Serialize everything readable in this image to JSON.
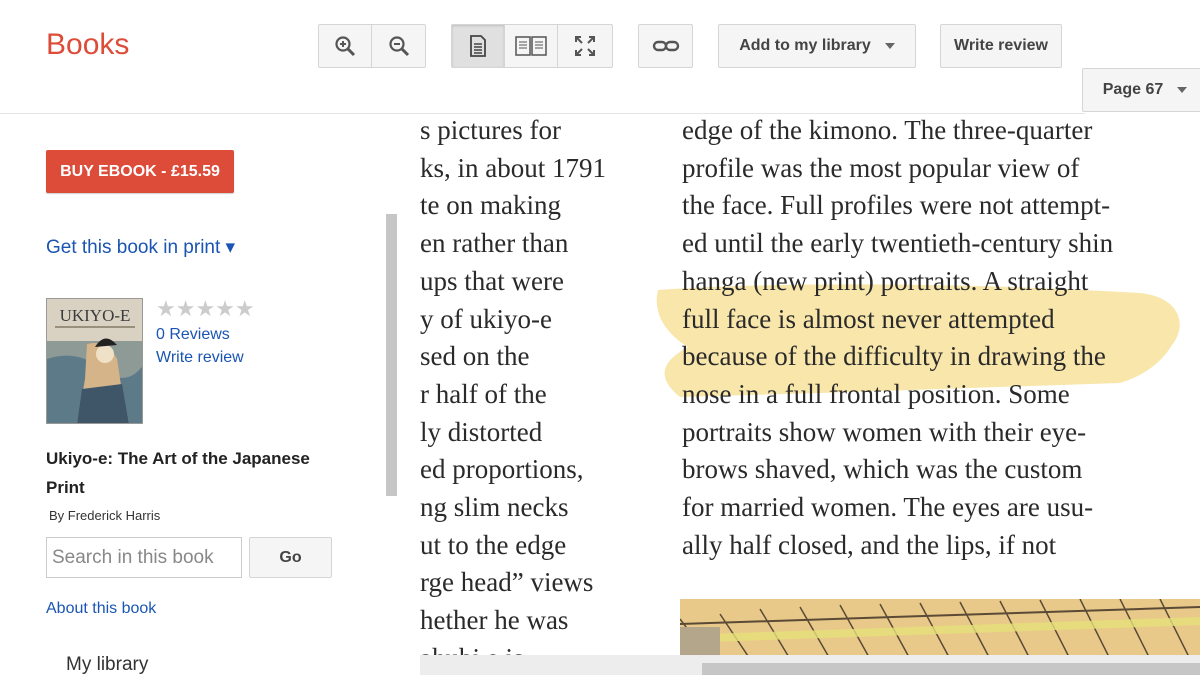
{
  "header": {
    "logo": "Books",
    "add_library": "Add to my library",
    "write_review": "Write review",
    "page_label": "Page 67"
  },
  "icons": [
    "zoom-in-icon",
    "zoom-out-icon",
    "single-page-icon",
    "two-page-icon",
    "fullscreen-icon",
    "link-icon"
  ],
  "sidebar": {
    "buy": "BUY EBOOK - £15.59",
    "print": "Get this book in print ▾",
    "stars": "★★★★★",
    "reviews": "0 Reviews",
    "write_review": "Write review",
    "title": "Ukiyo-e: The Art of the Japanese Print",
    "author": "By Frederick Harris",
    "search_placeholder": "Search in this book",
    "go": "Go",
    "about": "About this book",
    "my_library": "My library",
    "cover_title": "UKIYO-E"
  },
  "page": {
    "left_column": [
      "s pictures for",
      "ks, in about 1791",
      "te on making",
      "en rather than",
      "ups that were",
      "y of ukiyo-e",
      "sed on the",
      "r half of the",
      "ly distorted",
      "ed proportions,",
      "ng slim necks",
      "ut to the edge",
      "rge head” views",
      "hether he was",
      "ahubi e is"
    ],
    "right_column": [
      "edge of the kimono. The three-quarter",
      "profile was the most popular view of",
      "the face. Full profiles were not attempt-",
      "ed until the early twentieth-century shin",
      "hanga (new print) portraits. A straight",
      "full face is almost never attempted",
      "because of the difficulty in drawing the",
      "nose in a full frontal position. Some",
      "portraits show women with their eye-",
      "brows shaved, which was the custom",
      "for married women. The eyes are usu-",
      "ally half closed, and the lips, if not"
    ]
  },
  "colors": {
    "accent": "#dd4b39",
    "link": "#1a55b3",
    "highlight": "#f6dd8f"
  }
}
